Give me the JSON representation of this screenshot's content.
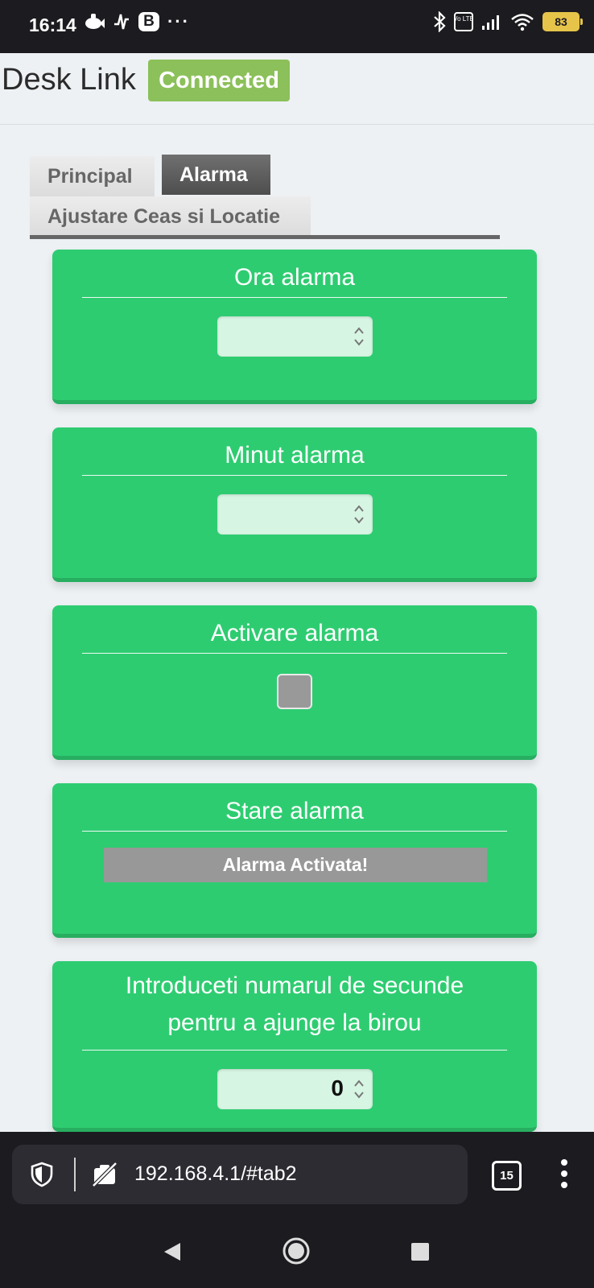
{
  "status_bar": {
    "time": "16:14",
    "left_icons": [
      "fish-app-icon",
      "signal-trace-icon",
      "b-app-icon",
      "more-notifications-icon"
    ],
    "b_label": "B",
    "more": "···",
    "right_icons": [
      "bluetooth-icon",
      "volte-icon",
      "cell-signal-icon",
      "wifi-icon",
      "battery-icon"
    ],
    "battery": "83",
    "volte_label": "Vo LTE",
    "battery_color": "#e6c44a"
  },
  "header": {
    "title": "Desk Link",
    "connection_status": "Connected",
    "connection_color": "#8cc05a"
  },
  "tabs": [
    {
      "label": "Principal",
      "active": false
    },
    {
      "label": "Alarma",
      "active": true
    },
    {
      "label": "Ajustare Ceas si Locatie",
      "active": false
    }
  ],
  "cards": {
    "hour": {
      "title": "Ora alarma",
      "value": ""
    },
    "minute": {
      "title": "Minut alarma",
      "value": ""
    },
    "activate": {
      "title": "Activare alarma",
      "checked": false
    },
    "state": {
      "title": "Stare alarma",
      "status": "Alarma Activata!"
    },
    "commute": {
      "title_line1": "Introduceti numarul de secunde",
      "title_line2": "pentru a ajunge la birou",
      "value": "0"
    }
  },
  "colors": {
    "card_bg": "#2ecc71",
    "card_border": "#27ae60",
    "input_bg": "#d7f5e3",
    "status_bg": "#989898"
  },
  "browser": {
    "url": "192.168.4.1/#tab2",
    "tab_count": "15",
    "icons": [
      "shield-icon",
      "no-camera-icon",
      "tab-switcher-icon",
      "menu-kebab-icon"
    ]
  },
  "nav": {
    "icons": [
      "back-icon",
      "home-icon",
      "recents-icon"
    ]
  }
}
